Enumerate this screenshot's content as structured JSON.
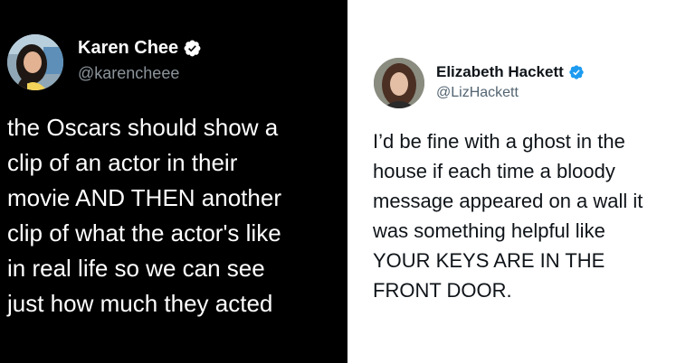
{
  "colors": {
    "left_background": "#000000",
    "right_background": "#ffffff",
    "verified_blue": "#1d9bf0"
  },
  "left_tweet": {
    "display_name": "Karen Chee",
    "handle": "@karencheee",
    "verified_icon": "verified-badge-icon",
    "text": "the Oscars should show a\nclip of an actor in their\nmovie AND THEN another\nclip of what the actor's like\nin real life so we can see\njust how much they acted"
  },
  "right_tweet": {
    "display_name": "Elizabeth Hackett",
    "handle": "@LizHackett",
    "verified_icon": "verified-badge-icon",
    "text": "I’d be fine with a ghost in the\nhouse if each time a bloody\nmessage appeared on a wall it\nwas something helpful like\nYOUR KEYS ARE IN THE\nFRONT DOOR."
  }
}
